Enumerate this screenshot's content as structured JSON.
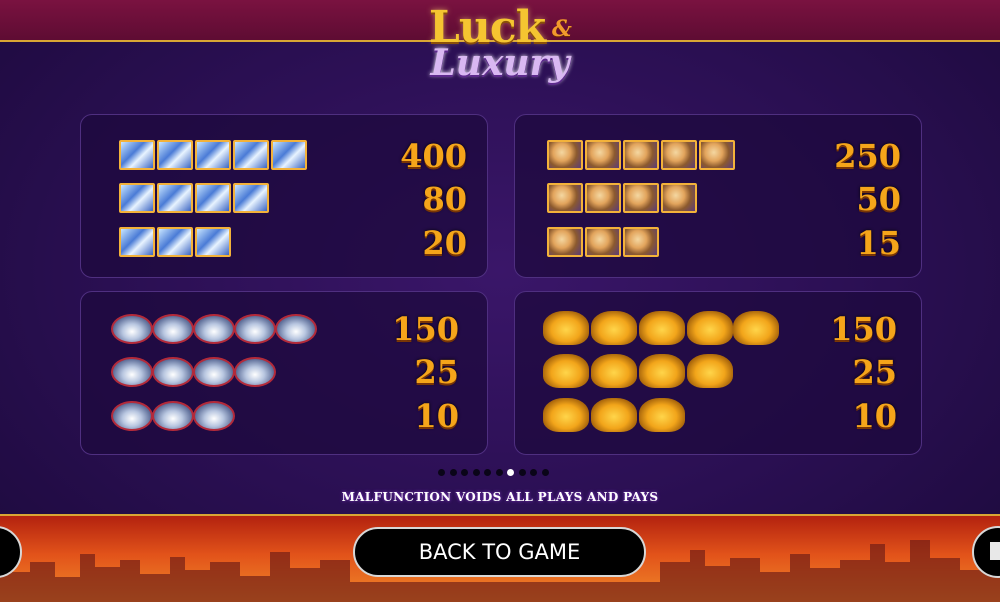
{
  "logo": {
    "line1": "Luck",
    "amp": "&",
    "line2": "Luxury"
  },
  "paytable": [
    {
      "symbol": "diamond-box-icon",
      "rows": [
        {
          "count": 5,
          "pay": "400"
        },
        {
          "count": 4,
          "pay": "80"
        },
        {
          "count": 3,
          "pay": "20"
        }
      ]
    },
    {
      "symbol": "woman-portrait-icon",
      "rows": [
        {
          "count": 5,
          "pay": "250"
        },
        {
          "count": 4,
          "pay": "50"
        },
        {
          "count": 3,
          "pay": "15"
        }
      ]
    },
    {
      "symbol": "gem-icon",
      "rows": [
        {
          "count": 5,
          "pay": "150"
        },
        {
          "count": 4,
          "pay": "25"
        },
        {
          "count": 3,
          "pay": "10"
        }
      ]
    },
    {
      "symbol": "sports-car-icon",
      "rows": [
        {
          "count": 5,
          "pay": "150"
        },
        {
          "count": 4,
          "pay": "25"
        },
        {
          "count": 3,
          "pay": "10"
        }
      ]
    }
  ],
  "pagination": {
    "total": 10,
    "active": 7
  },
  "disclaimer": "MALFUNCTION VOIDS ALL PLAYS AND PAYS",
  "back_button": "BACK TO GAME"
}
